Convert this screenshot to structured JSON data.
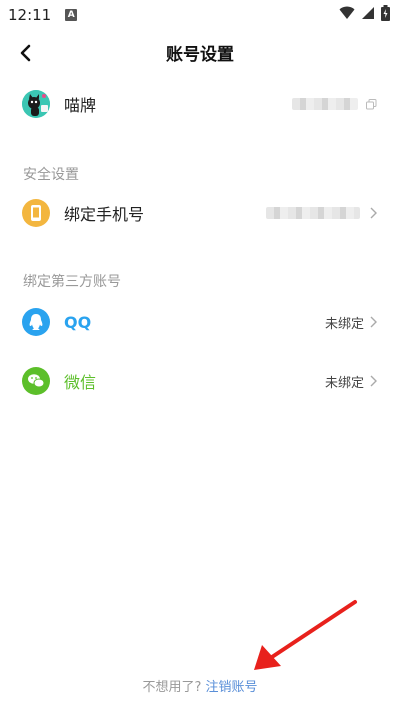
{
  "status_bar": {
    "time": "12:11",
    "badge": "A"
  },
  "header": {
    "title": "账号设置"
  },
  "profile": {
    "name": "喵牌"
  },
  "security": {
    "section_title": "安全设置",
    "bind_phone_label": "绑定手机号"
  },
  "third_party": {
    "section_title": "绑定第三方账号",
    "items": [
      {
        "label": "QQ",
        "status": "未绑定",
        "color": "#2aa3ef"
      },
      {
        "label": "微信",
        "status": "未绑定",
        "color": "#5cbf2a"
      }
    ]
  },
  "footer": {
    "question": "不想用了?",
    "link": "注销账号"
  },
  "colors": {
    "link": "#5a8fd8",
    "phone_icon_bg": "#f3b63f",
    "qq_icon_bg": "#2aa3ef",
    "wechat_icon_bg": "#5cbf2a",
    "arrow": "#e8211c"
  }
}
